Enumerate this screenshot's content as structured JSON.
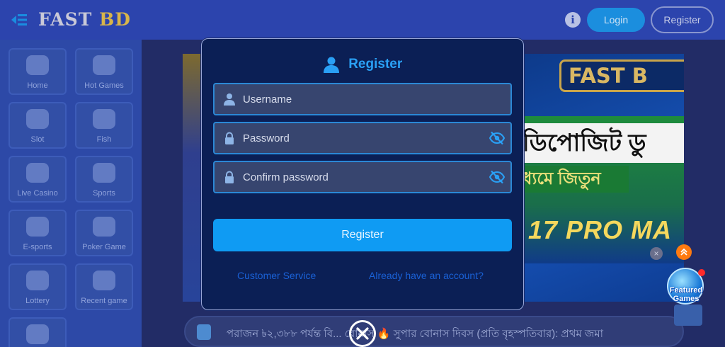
{
  "topbar": {
    "logo_fast": "FAST",
    "logo_bd": "BD",
    "info_glyph": "i",
    "login_label": "Login",
    "register_label": "Register"
  },
  "sidebar": {
    "items": [
      {
        "label": "Home",
        "icon": "home-icon"
      },
      {
        "label": "Hot Games",
        "icon": "flame-icon"
      },
      {
        "label": "Slot",
        "icon": "slot-icon"
      },
      {
        "label": "Fish",
        "icon": "fish-icon"
      },
      {
        "label": "Live Casino",
        "icon": "live-casino-icon"
      },
      {
        "label": "Sports",
        "icon": "soccer-ball-icon"
      },
      {
        "label": "E-sports",
        "icon": "versus-icon"
      },
      {
        "label": "Poker Game",
        "icon": "cards-icon"
      },
      {
        "label": "Lottery",
        "icon": "lottery-balls-icon"
      },
      {
        "label": "Recent game",
        "icon": "clock-icon"
      },
      {
        "label": "",
        "icon": "heart-icon"
      }
    ]
  },
  "banner": {
    "title": "FAST B",
    "line1": "ডিপোজিট ডু",
    "line2": "ধ্যমে জিতুন",
    "line3": "17 PRO MA"
  },
  "marquee": {
    "text": "পরাজন ৳২,৩৮৮ পর্যন্ত বি... বোনাস 🔥 সুপার বোনাস দিবস (প্রতি বৃহস্পতিবার): প্রথম জমা"
  },
  "featured": {
    "close_glyph": "×",
    "label": "Featured Games"
  },
  "modal": {
    "title": "Register",
    "username_placeholder": "Username",
    "password_placeholder": "Password",
    "confirm_placeholder": "Confirm password",
    "submit_label": "Register",
    "customer_service": "Customer Service",
    "have_account": "Already have an account?"
  },
  "colors": {
    "accent": "#0f9bf3",
    "modal_bg": "#0b1f55",
    "link": "#1a61d6",
    "field_border": "#2b88d6"
  }
}
